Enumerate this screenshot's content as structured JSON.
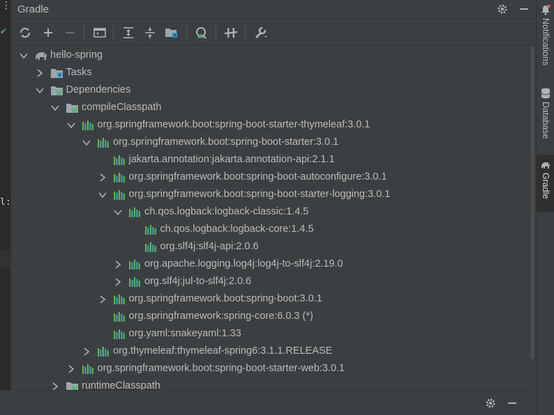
{
  "panel": {
    "title": "Gradle"
  },
  "editor": {
    "fragment": "l:"
  },
  "stripe": {
    "items": [
      {
        "label": "Notifications",
        "icon": "bell-icon"
      },
      {
        "label": "Database",
        "icon": "database-icon"
      },
      {
        "label": "Gradle",
        "icon": "elephant-icon",
        "active": true
      }
    ]
  },
  "tree": {
    "nodes": [
      {
        "label": "hello-spring",
        "icon": "elephant-icon",
        "state": "expanded",
        "level": 0
      },
      {
        "label": "Tasks",
        "icon": "tasks-folder-icon",
        "state": "collapsed",
        "level": 1
      },
      {
        "label": "Dependencies",
        "icon": "dependencies-folder-icon",
        "state": "expanded",
        "level": 1
      },
      {
        "label": "compileClasspath",
        "icon": "classpath-folder-icon",
        "state": "expanded",
        "level": 2
      },
      {
        "label": "org.springframework.boot:spring-boot-starter-thymeleaf:3.0.1",
        "icon": "library-icon",
        "state": "expanded",
        "level": 3
      },
      {
        "label": "org.springframework.boot:spring-boot-starter:3.0.1",
        "icon": "library-icon",
        "state": "expanded",
        "level": 4
      },
      {
        "label": "jakarta.annotation:jakarta.annotation-api:2.1.1",
        "icon": "library-icon",
        "state": "leaf",
        "level": 5
      },
      {
        "label": "org.springframework.boot:spring-boot-autoconfigure:3.0.1",
        "icon": "library-icon",
        "state": "collapsed",
        "level": 5
      },
      {
        "label": "org.springframework.boot:spring-boot-starter-logging:3.0.1",
        "icon": "library-icon",
        "state": "expanded",
        "level": 5
      },
      {
        "label": "ch.qos.logback:logback-classic:1.4.5",
        "icon": "library-icon",
        "state": "expanded",
        "level": 6
      },
      {
        "label": "ch.qos.logback:logback-core:1.4.5",
        "icon": "library-icon",
        "state": "leaf",
        "level": 7
      },
      {
        "label": "org.slf4j:slf4j-api:2.0.6",
        "icon": "library-icon",
        "state": "leaf",
        "level": 7
      },
      {
        "label": "org.apache.logging.log4j:log4j-to-slf4j:2.19.0",
        "icon": "library-icon",
        "state": "collapsed",
        "level": 6
      },
      {
        "label": "org.slf4j:jul-to-slf4j:2.0.6",
        "icon": "library-icon",
        "state": "collapsed",
        "level": 6
      },
      {
        "label": "org.springframework.boot:spring-boot:3.0.1",
        "icon": "library-icon",
        "state": "collapsed",
        "level": 5
      },
      {
        "label": "org.springframework:spring-core:6.0.3 (*)",
        "icon": "library-icon",
        "state": "leaf",
        "level": 5
      },
      {
        "label": "org.yaml:snakeyaml:1.33",
        "icon": "library-icon",
        "state": "leaf",
        "level": 5
      },
      {
        "label": "org.thymeleaf:thymeleaf-spring6:3.1.1.RELEASE",
        "icon": "library-icon",
        "state": "collapsed",
        "level": 4
      },
      {
        "label": "org.springframework.boot:spring-boot-starter-web:3.0.1",
        "icon": "library-icon",
        "state": "collapsed",
        "level": 3
      },
      {
        "label": "runtimeClasspath",
        "icon": "classpath-folder-icon",
        "state": "collapsed",
        "level": 2
      }
    ]
  },
  "colors": {
    "background": "#3c3f41",
    "text": "#bbbbbb",
    "lib_bar_green": "#62b543",
    "lib_bar_blue": "#389fd6",
    "elephant": "#9aa7b0"
  }
}
